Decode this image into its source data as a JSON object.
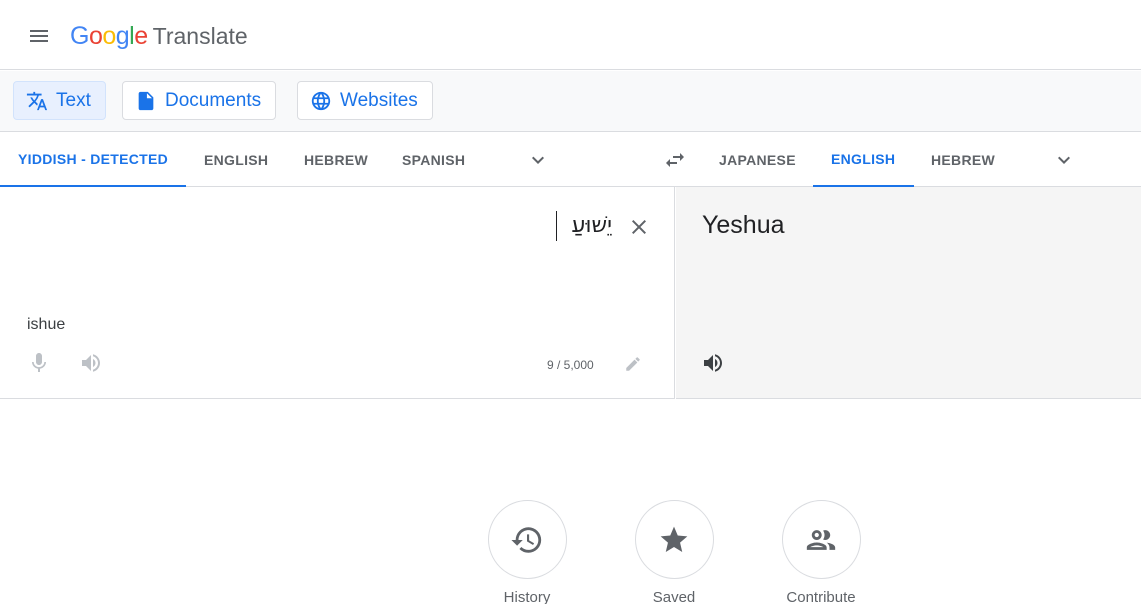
{
  "header": {
    "logo_google_letters": [
      "G",
      "o",
      "o",
      "g",
      "l",
      "e"
    ],
    "logo_colors": [
      "#4285f4",
      "#ea4335",
      "#fbbc05",
      "#4285f4",
      "#34a853",
      "#ea4335"
    ],
    "logo_translate": "Translate"
  },
  "modes": [
    {
      "label": "Text",
      "icon": "translate-icon",
      "active": true
    },
    {
      "label": "Documents",
      "icon": "document-icon",
      "active": false
    },
    {
      "label": "Websites",
      "icon": "globe-icon",
      "active": false
    }
  ],
  "source_langs": [
    "YIDDISH - DETECTED",
    "ENGLISH",
    "HEBREW",
    "SPANISH"
  ],
  "target_langs": [
    "JAPANESE",
    "ENGLISH",
    "HEBREW"
  ],
  "source": {
    "text": "יֵשׁוּעַ",
    "romanization": "ishue",
    "char_count": "9 / 5,000"
  },
  "target": {
    "text": "Yeshua"
  },
  "actions": [
    {
      "label": "History",
      "icon": "history-icon"
    },
    {
      "label": "Saved",
      "icon": "star-icon"
    },
    {
      "label": "Contribute",
      "icon": "people-icon"
    }
  ],
  "colors": {
    "accent": "#1a73e8",
    "active_mode_bg": "#e8f0fe",
    "icon_gray": "#5f6368",
    "target_bg": "#f5f5f5"
  }
}
